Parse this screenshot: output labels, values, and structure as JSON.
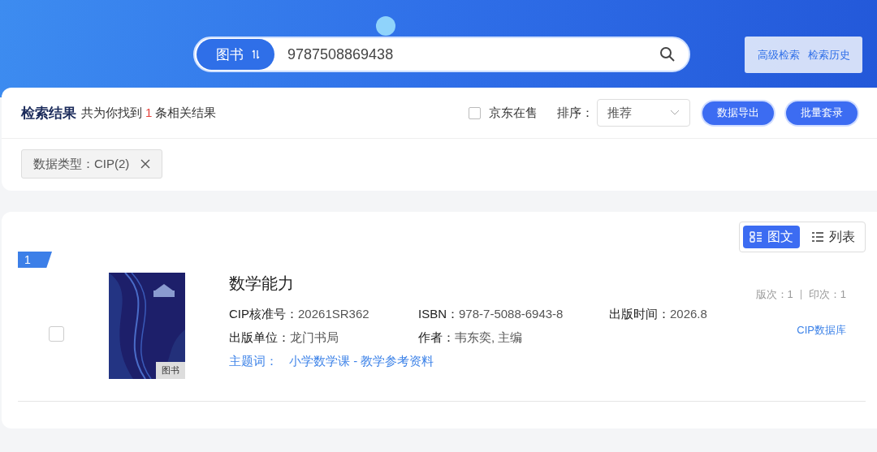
{
  "search": {
    "type_label": "图书",
    "value": "9787508869438"
  },
  "header_links": [
    "高级检索",
    "检索历史"
  ],
  "results": {
    "title": "检索结果",
    "before": "共为你找到",
    "count": "1",
    "after": "条相关结果"
  },
  "jd_filter": {
    "label": "京东在售",
    "checked": false
  },
  "sort": {
    "label": "排序：",
    "value": "推荐"
  },
  "buttons": [
    "数据导出",
    "批量套录"
  ],
  "filters": [
    {
      "label": "数据类型：CIP(2)"
    }
  ],
  "view_modes": [
    {
      "label": "图文",
      "selected": true
    },
    {
      "label": "列表",
      "selected": false
    }
  ],
  "items": [
    {
      "index": "1",
      "checked": false,
      "cover": {
        "kind": "picture",
        "badge": "图书"
      },
      "title": "数学能力",
      "edition": "版次：1",
      "printing": "印次：1",
      "fields": [
        {
          "label": "CIP核准号：",
          "value": "20261SR362"
        },
        {
          "label": "ISBN：",
          "value": "978-7-5088-6943-8"
        },
        {
          "label": "出版时间：",
          "value": "2026.8"
        },
        {
          "label": "出版单位：",
          "value": "龙门书局"
        },
        {
          "label": "作者：",
          "value": "韦东奕, 主编"
        }
      ],
      "subject_label": "主题词：",
      "subject": "小学数学课 - 教学参考资料",
      "source": "CIP数据库"
    }
  ]
}
